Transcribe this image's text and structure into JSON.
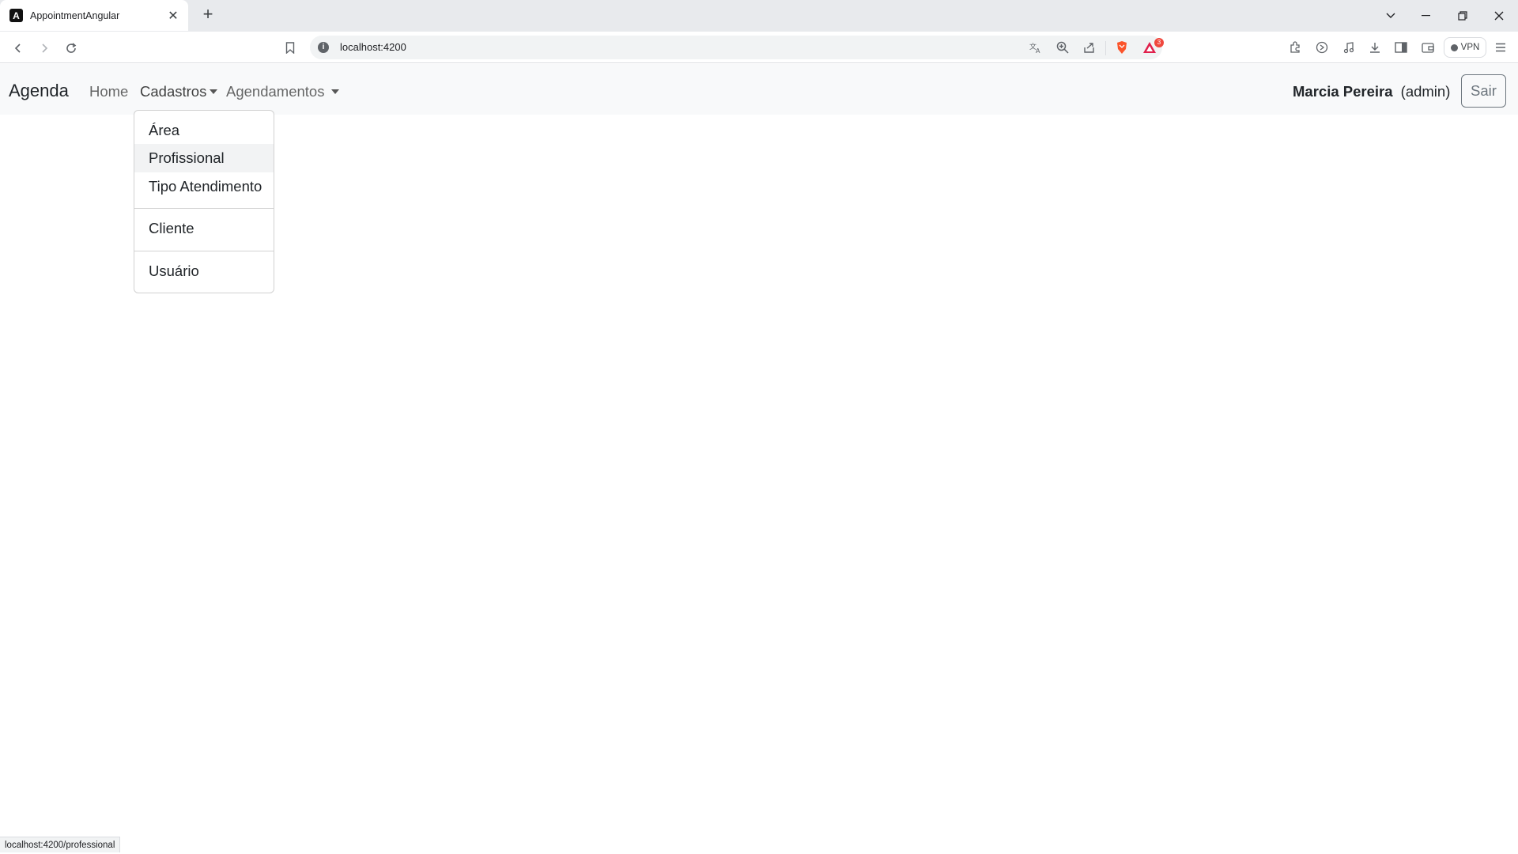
{
  "browser": {
    "tab_title": "AppointmentAngular",
    "tab_favicon_letter": "A",
    "new_tab_icon": "plus-icon",
    "url": "localhost:4200",
    "vpn_label": "VPN",
    "notification_count": "3",
    "status_url": "localhost:4200/professional"
  },
  "navbar": {
    "brand": "Agenda",
    "home": "Home",
    "cadastros": "Cadastros",
    "agendamentos": "Agendamentos",
    "user_name": "Marcia Pereira",
    "user_role": "(admin)",
    "logout": "Sair"
  },
  "dropdown": {
    "items": [
      "Área",
      "Profissional",
      "Tipo Atendimento",
      "Cliente",
      "Usuário"
    ],
    "hovered_item": "Profissional"
  }
}
